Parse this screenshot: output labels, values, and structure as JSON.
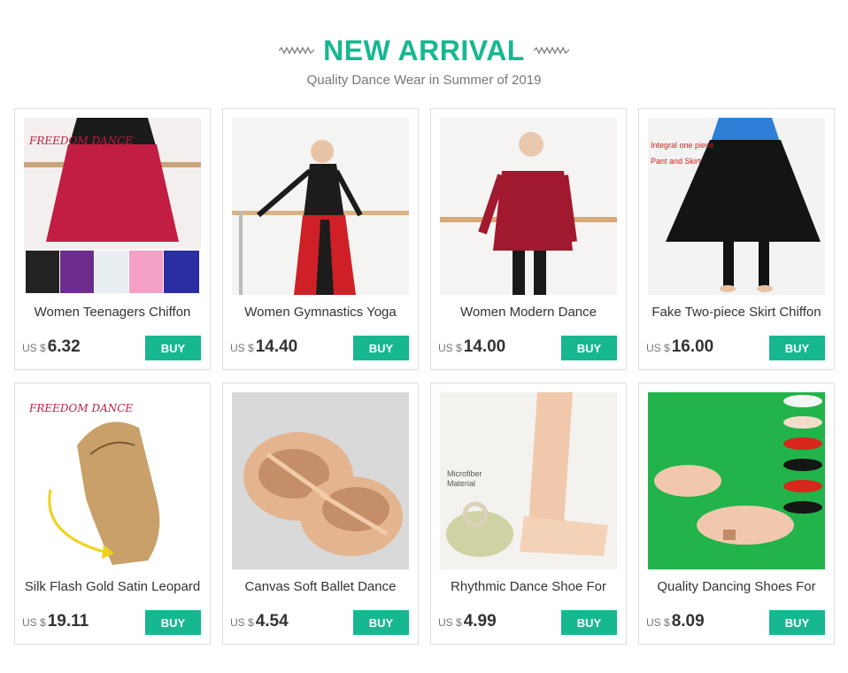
{
  "header": {
    "title": "NEW ARRIVAL",
    "subtitle": "Quality Dance Wear in Summer of 2019"
  },
  "colors": {
    "accent": "#17b890",
    "text": "#333333",
    "muted": "#777777",
    "border": "#dcdcdc"
  },
  "buy_label": "BUY",
  "products": [
    {
      "name": "Women Teenagers Chiffon",
      "currency": "US $",
      "price": "6.32",
      "image_text": "FREEDOM DANCE"
    },
    {
      "name": "Women Gymnastics Yoga",
      "currency": "US $",
      "price": "14.40"
    },
    {
      "name": "Women Modern Dance",
      "currency": "US $",
      "price": "14.00"
    },
    {
      "name": "Fake Two-piece Skirt Chiffon",
      "currency": "US $",
      "price": "16.00",
      "image_text_1": "Integral one piece",
      "image_text_2": "Pant and Skirt"
    },
    {
      "name": "Silk Flash Gold Satin Leopard",
      "currency": "US $",
      "price": "19.11",
      "image_text": "FREEDOM DANCE"
    },
    {
      "name": "Canvas Soft Ballet Dance",
      "currency": "US $",
      "price": "4.54"
    },
    {
      "name": "Rhythmic Dance Shoe For",
      "currency": "US $",
      "price": "4.99",
      "image_text_1": "Microfiber",
      "image_text_2": "Material"
    },
    {
      "name": "Quality Dancing Shoes For",
      "currency": "US $",
      "price": "8.09"
    }
  ]
}
